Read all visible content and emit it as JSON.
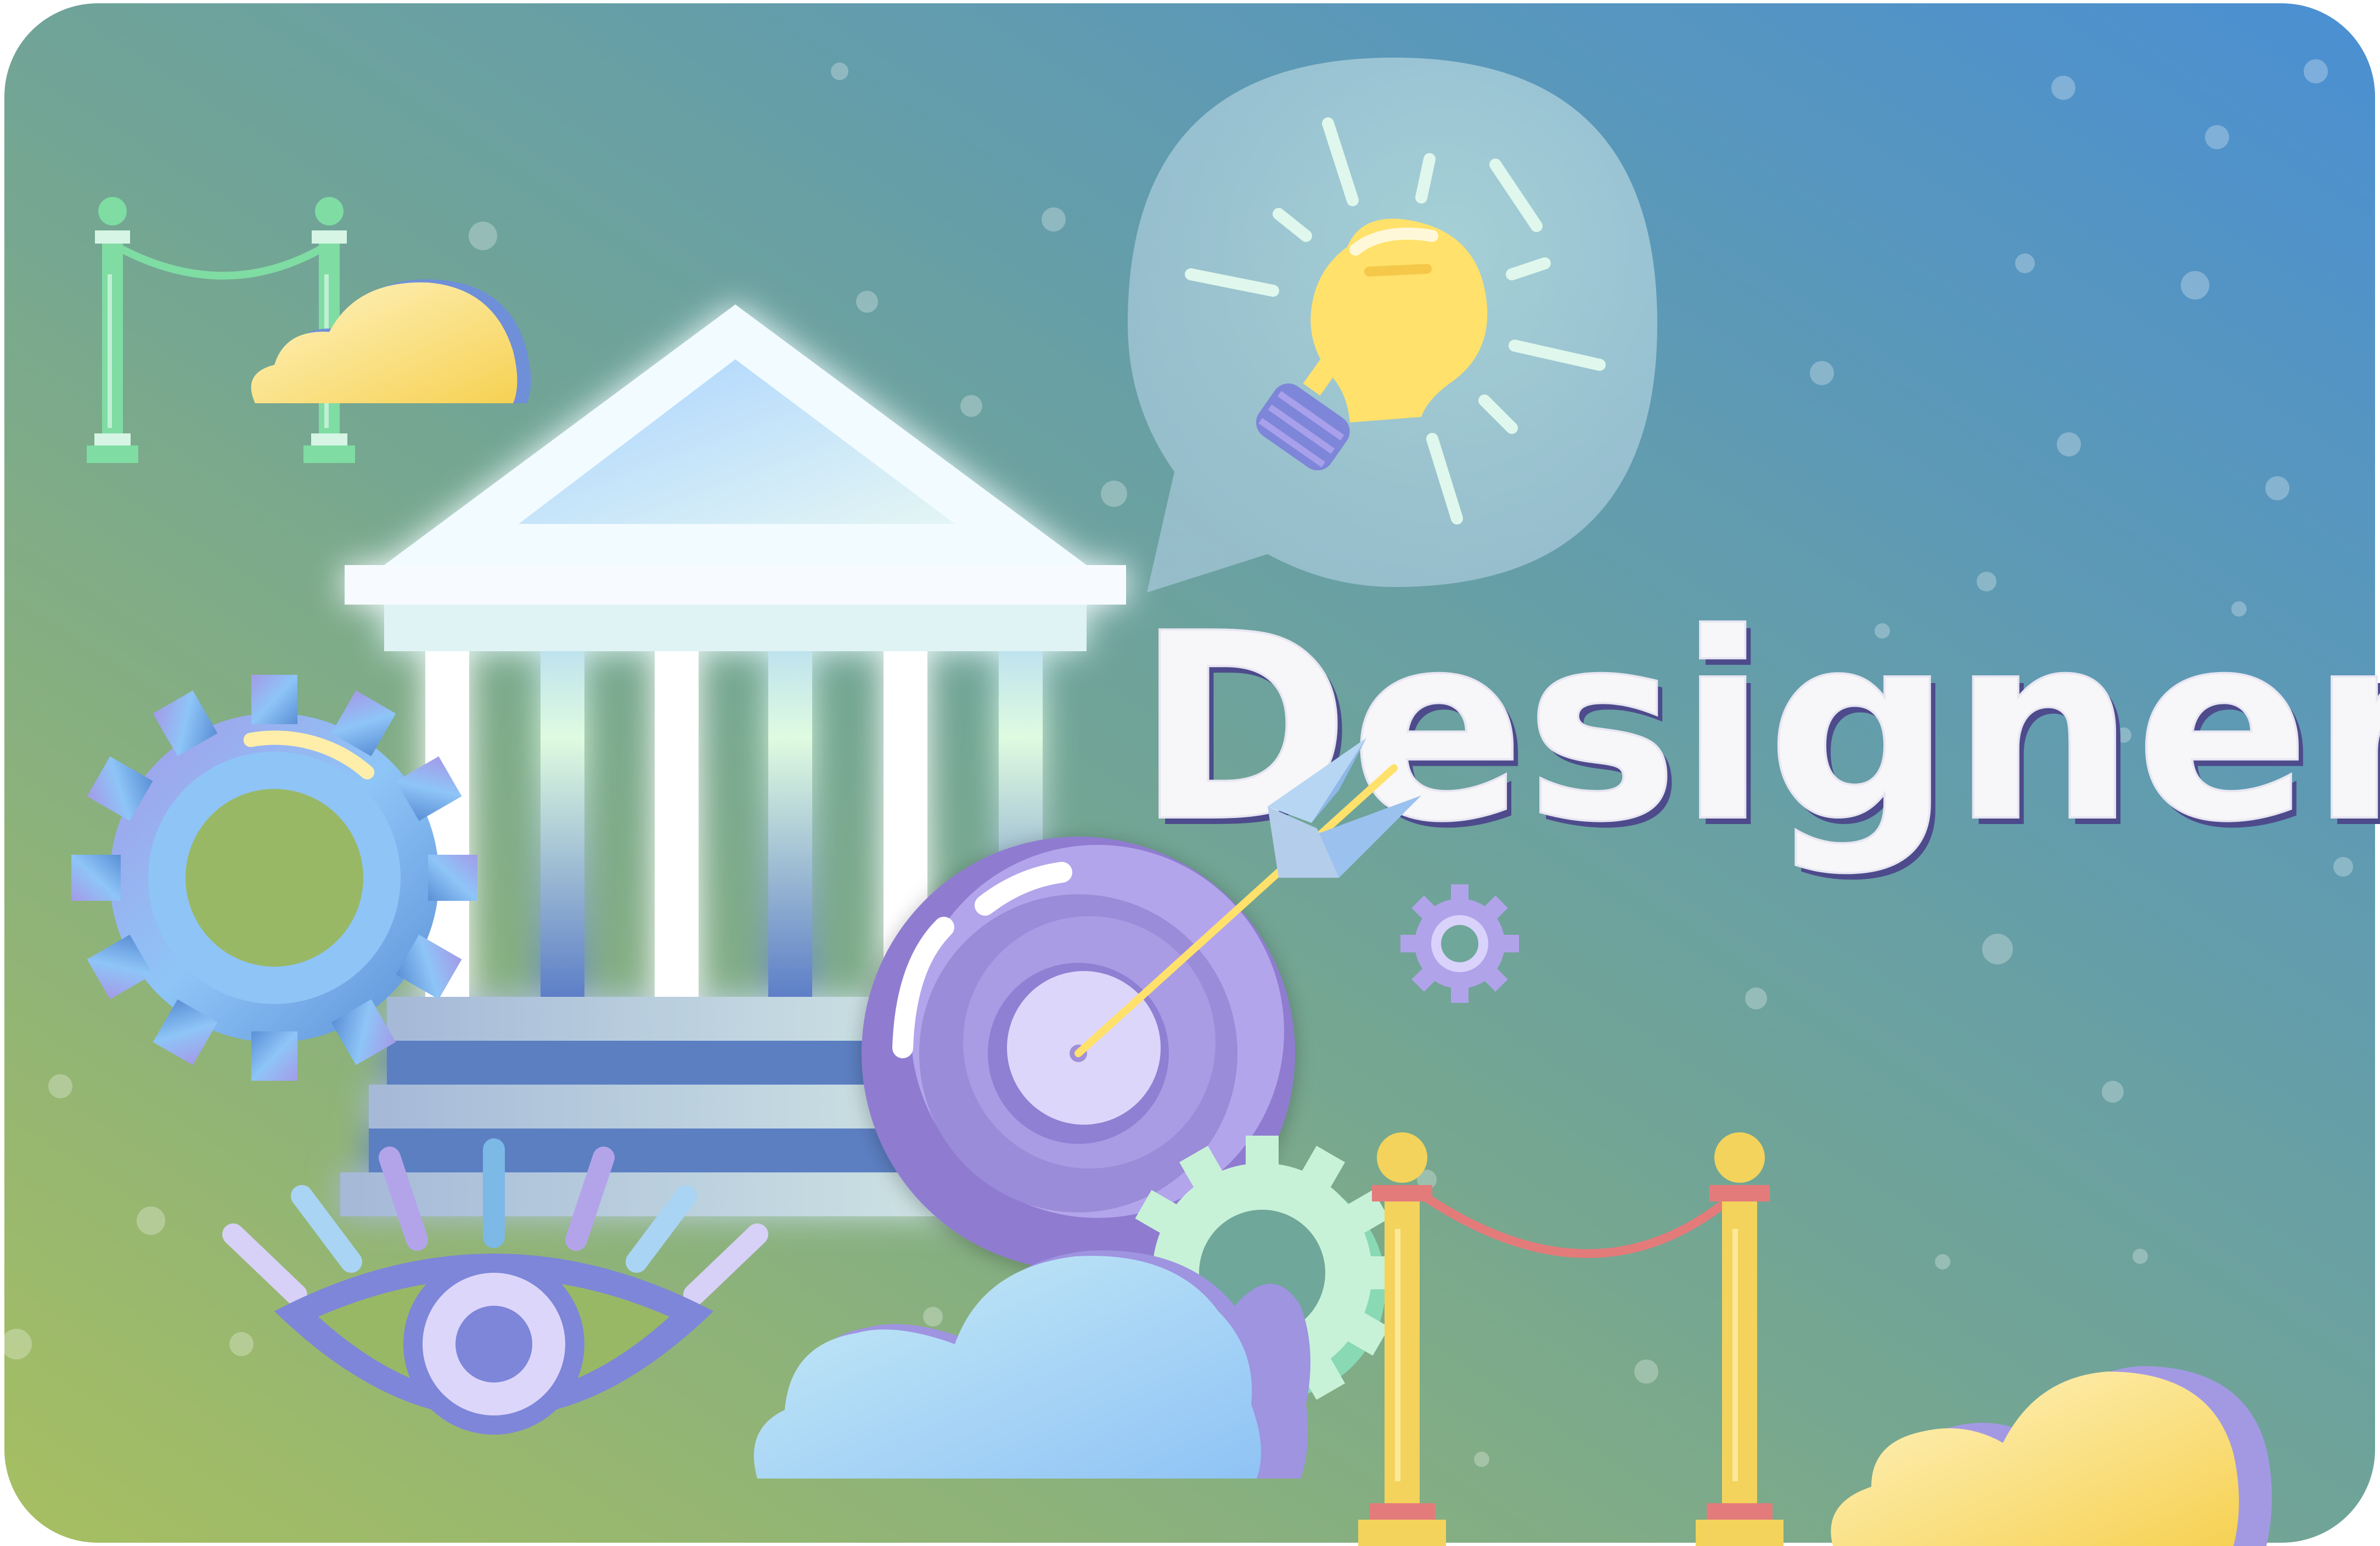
{
  "illustration": {
    "title": "Designer",
    "colors": {
      "bg_top_right": "#4a90d2",
      "bg_mid": "#6ea89d",
      "bg_bottom_left": "#9fbd6a",
      "title_fill": "#f7f6f8",
      "title_shadow": "#4d4b8c",
      "gear_blue": "#8ec1f5",
      "gear_purple": "#a898e6",
      "gear_mint": "#c8f2d8",
      "bulb_yellow": "#ffe16b",
      "cloud_yellow": "#ffe89a",
      "cloud_blue": "#a9d6f7",
      "stanchion_gold": "#f3d35b",
      "stanchion_green": "#7fdca3",
      "rope_red": "#e47b7b",
      "target_purple": "#a28fe0"
    },
    "icons": [
      "museum-building-icon",
      "lightbulb-icon",
      "speech-bubble-icon",
      "gear-icon",
      "target-icon",
      "arrow-icon",
      "eye-icon",
      "cloud-icon",
      "stanchion-rope-icon"
    ]
  }
}
